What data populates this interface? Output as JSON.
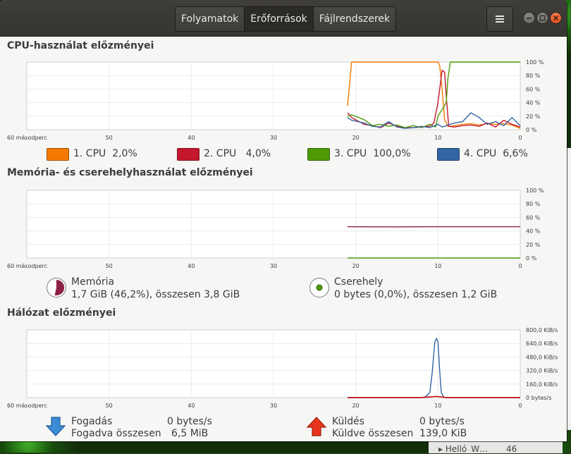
{
  "header": {
    "tabs": [
      {
        "label": "Folyamatok",
        "active": false
      },
      {
        "label": "Erőforrások",
        "active": true
      },
      {
        "label": "Fájlrendszerek",
        "active": false
      }
    ]
  },
  "sections": {
    "cpu_title": "CPU-használat előzményei",
    "mem_title": "Memória- és cserehelyhasználat előzményei",
    "net_title": "Hálózat előzményei"
  },
  "x_axis": {
    "left_label": "60 másodperc",
    "ticks": [
      "50",
      "40",
      "30",
      "20",
      "10",
      "0"
    ]
  },
  "cpu": {
    "legend": [
      {
        "label": "1. CPU",
        "value": "2,0%",
        "color": "#f57900"
      },
      {
        "label": "2. CPU",
        "value": "4,0%",
        "color": "#c4172d"
      },
      {
        "label": "3. CPU",
        "value": "100,0%",
        "color": "#4e9a06"
      },
      {
        "label": "4. CPU",
        "value": "6,6%",
        "color": "#3465a4"
      }
    ]
  },
  "memory": {
    "mem_label": "Memória",
    "mem_value": "1,7 GiB (46,2%), összesen 3,8 GiB",
    "swap_label": "Cserehely",
    "swap_value": "0 bytes (0,0%), összesen 1,2 GiB",
    "mem_color": "#8e1f47",
    "swap_color": "#4e9a06"
  },
  "network": {
    "recv_label": "Fogadás",
    "recv_value": "0 bytes/s",
    "recv_total_label": "Fogadva összesen",
    "recv_total_value": "6,5 MiB",
    "send_label": "Küldés",
    "send_value": "0 bytes/s",
    "send_total_label": "Küldve összesen",
    "send_total_value": "139,0 KiB"
  },
  "chart_data": [
    {
      "type": "line",
      "title": "CPU-használat előzményei",
      "x_unit": "seconds ago",
      "xlim": [
        60,
        0
      ],
      "ylim": [
        0,
        100
      ],
      "y_ticks": [
        "100 %",
        "80 %",
        "60 %",
        "40 %",
        "20 %",
        "0 %"
      ],
      "grid": true,
      "series": [
        {
          "name": "1. CPU",
          "color": "#f57900",
          "points": [
            [
              21,
              35
            ],
            [
              20.5,
              100
            ],
            [
              19,
              100
            ],
            [
              15,
              100
            ],
            [
              11,
              100
            ],
            [
              10,
              100
            ],
            [
              9.8,
              95
            ],
            [
              9.5,
              60
            ],
            [
              9.2,
              15
            ],
            [
              8.8,
              5
            ],
            [
              8.5,
              5
            ],
            [
              8,
              6
            ],
            [
              7,
              8
            ],
            [
              6,
              9
            ],
            [
              5,
              7
            ],
            [
              4,
              9
            ],
            [
              3,
              8
            ],
            [
              2,
              9
            ],
            [
              1,
              7
            ],
            [
              0,
              2
            ]
          ]
        },
        {
          "name": "2. CPU",
          "color": "#c4172d",
          "points": [
            [
              21,
              25
            ],
            [
              20.5,
              18
            ],
            [
              19,
              8
            ],
            [
              18,
              6
            ],
            [
              17,
              3
            ],
            [
              16,
              10
            ],
            [
              15,
              5
            ],
            [
              14,
              3
            ],
            [
              13,
              3
            ],
            [
              12,
              4
            ],
            [
              11,
              5
            ],
            [
              10.5,
              10
            ],
            [
              10,
              40
            ],
            [
              9.5,
              88
            ],
            [
              9.2,
              85
            ],
            [
              9,
              50
            ],
            [
              8.7,
              5
            ],
            [
              8,
              4
            ],
            [
              7,
              6
            ],
            [
              6,
              7
            ],
            [
              5,
              5
            ],
            [
              4,
              10
            ],
            [
              3,
              4
            ],
            [
              2,
              14
            ],
            [
              1,
              8
            ],
            [
              0,
              4
            ]
          ]
        },
        {
          "name": "3. CPU",
          "color": "#4e9a06",
          "points": [
            [
              21,
              20
            ],
            [
              20.5,
              22
            ],
            [
              19,
              15
            ],
            [
              18,
              6
            ],
            [
              17,
              8
            ],
            [
              16,
              5
            ],
            [
              15,
              7
            ],
            [
              14,
              3
            ],
            [
              13,
              6
            ],
            [
              12,
              3
            ],
            [
              11,
              8
            ],
            [
              10.3,
              4
            ],
            [
              10,
              20
            ],
            [
              9.5,
              30
            ],
            [
              9,
              40
            ],
            [
              8.8,
              75
            ],
            [
              8.5,
              100
            ],
            [
              8,
              100
            ],
            [
              6,
              100
            ],
            [
              4,
              100
            ],
            [
              2,
              100
            ],
            [
              0,
              100
            ]
          ]
        },
        {
          "name": "4. CPU",
          "color": "#3465a4",
          "points": [
            [
              21,
              18
            ],
            [
              20.5,
              14
            ],
            [
              19,
              10
            ],
            [
              18,
              5
            ],
            [
              17,
              4
            ],
            [
              16,
              12
            ],
            [
              15,
              4
            ],
            [
              14,
              2
            ],
            [
              13,
              3
            ],
            [
              12,
              5
            ],
            [
              11,
              3
            ],
            [
              10,
              8
            ],
            [
              9.5,
              4
            ],
            [
              9,
              6
            ],
            [
              8,
              10
            ],
            [
              7,
              12
            ],
            [
              6,
              25
            ],
            [
              5,
              18
            ],
            [
              4,
              8
            ],
            [
              3,
              12
            ],
            [
              2,
              6
            ],
            [
              1,
              18
            ],
            [
              0,
              6
            ]
          ]
        }
      ]
    },
    {
      "type": "line",
      "title": "Memória- és cserehelyhasználat előzményei",
      "x_unit": "seconds ago",
      "xlim": [
        60,
        0
      ],
      "ylim": [
        0,
        100
      ],
      "y_ticks": [
        "100 %",
        "80 %",
        "60 %",
        "40 %",
        "20 %",
        "0 %"
      ],
      "grid": true,
      "series": [
        {
          "name": "Memória",
          "color": "#8e1f47",
          "points": [
            [
              21,
              46.2
            ],
            [
              15,
              46
            ],
            [
              10,
              46.2
            ],
            [
              5,
              46.2
            ],
            [
              0,
              46.2
            ]
          ]
        },
        {
          "name": "Cserehely",
          "color": "#4e9a06",
          "points": [
            [
              21,
              0
            ],
            [
              0,
              0
            ]
          ]
        }
      ]
    },
    {
      "type": "line",
      "title": "Hálózat előzményei",
      "x_unit": "seconds ago",
      "xlim": [
        60,
        0
      ],
      "ylim": [
        0,
        800
      ],
      "y_ticks": [
        "800,0 KiB/s",
        "640,0 KiB/s",
        "480,0 KiB/s",
        "320,0 KiB/s",
        "160,0 KiB/s",
        "0 bytes/s"
      ],
      "grid": true,
      "series": [
        {
          "name": "Fogadás",
          "color": "#3465a4",
          "points": [
            [
              21,
              0
            ],
            [
              12,
              0
            ],
            [
              11.5,
              10
            ],
            [
              11,
              60
            ],
            [
              10.7,
              300
            ],
            [
              10.4,
              650
            ],
            [
              10.2,
              700
            ],
            [
              10,
              660
            ],
            [
              9.8,
              320
            ],
            [
              9.6,
              60
            ],
            [
              9.3,
              5
            ],
            [
              9,
              0
            ],
            [
              5,
              0
            ],
            [
              0,
              0
            ]
          ]
        },
        {
          "name": "Küldés",
          "color": "#cc0000",
          "points": [
            [
              21,
              0
            ],
            [
              12,
              0
            ],
            [
              11,
              8
            ],
            [
              10.3,
              14
            ],
            [
              9.6,
              8
            ],
            [
              9,
              0
            ],
            [
              0,
              0
            ]
          ]
        }
      ]
    }
  ]
}
